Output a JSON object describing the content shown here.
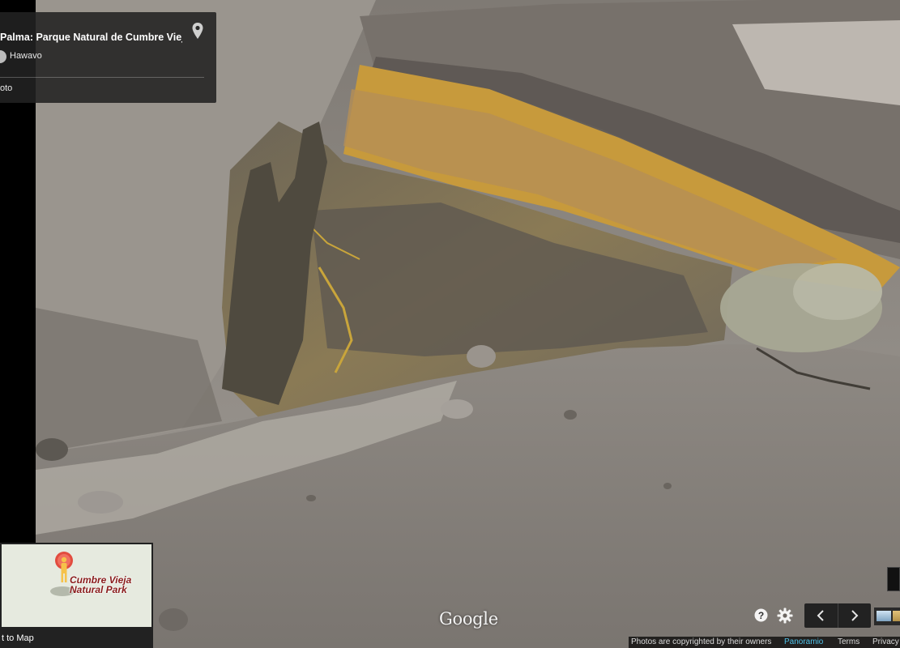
{
  "photo": {
    "subject": "crater-rock-face",
    "colors": {
      "sky_rock": "#8f8a84",
      "ochre": "#c79a3c",
      "dark_rock": "#5c5750",
      "ground": "#7d7873"
    }
  },
  "info_card": {
    "title": "Palma: Parque Natural de Cumbre Vieja",
    "author": "Hawavo",
    "link": "oto",
    "icon": "location-pin-icon"
  },
  "minimap": {
    "label": "Cumbre Vieja Natural Park",
    "back_link": "t to Map"
  },
  "watermark": "Google",
  "controls": {
    "help_icon": "help-icon",
    "settings_icon": "gear-icon",
    "prev_icon": "chevron-left-icon",
    "next_icon": "chevron-right-icon"
  },
  "footer": {
    "copyright": "Photos are copyrighted by their owners",
    "panoramio": "Panoramio",
    "terms": "Terms",
    "privacy": "Privacy"
  }
}
